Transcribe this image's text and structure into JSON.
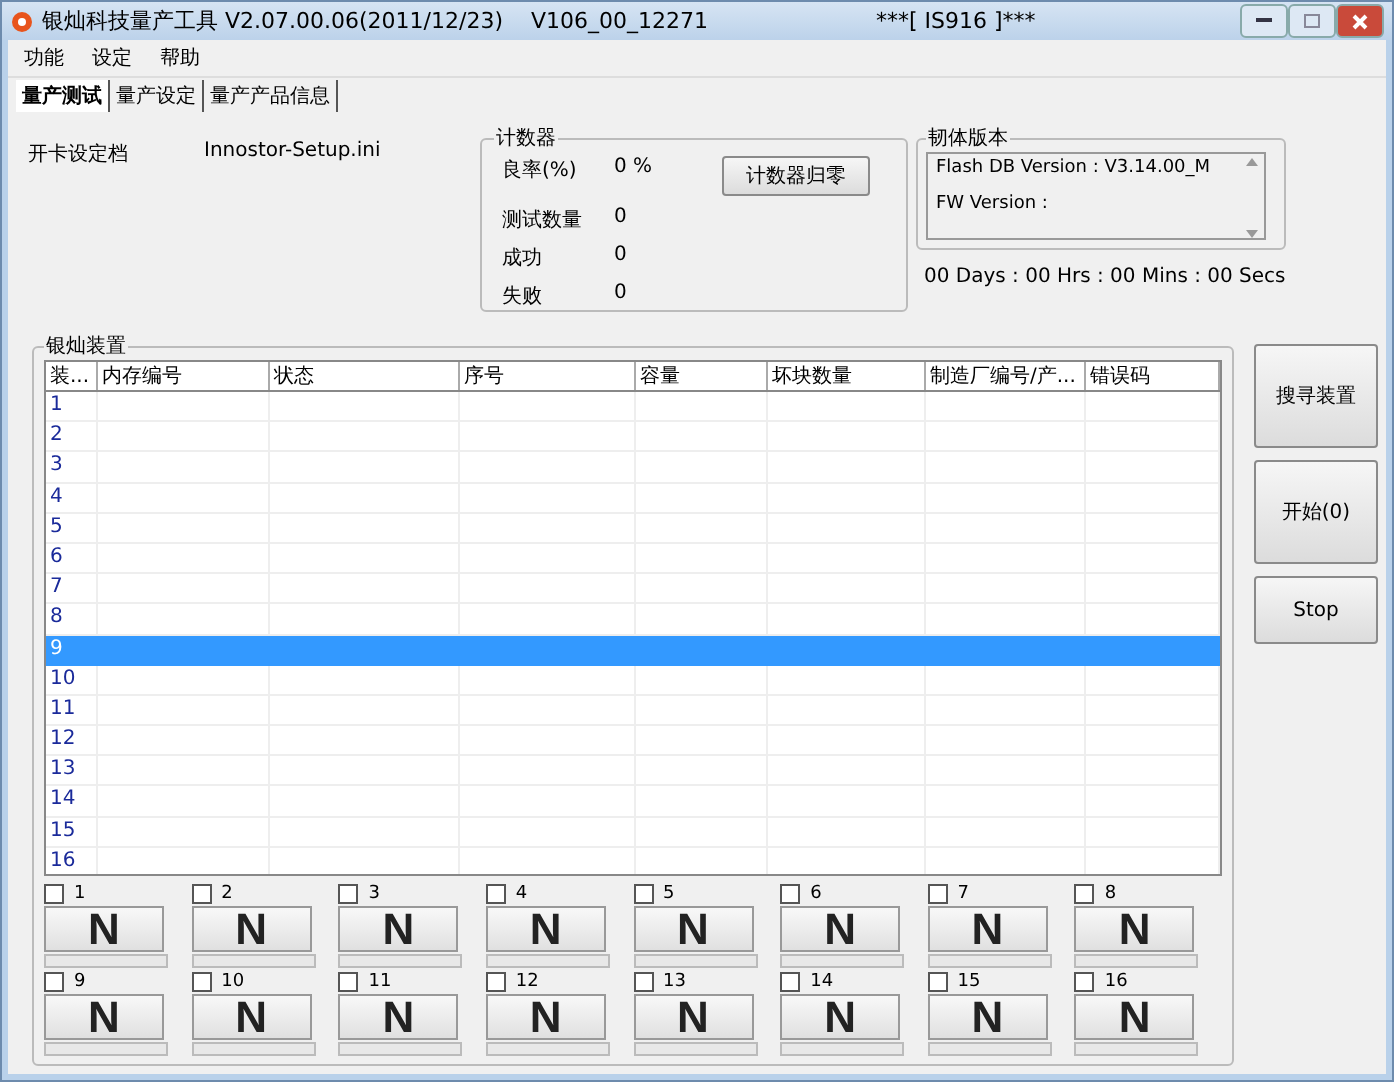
{
  "window": {
    "title": "银灿科技量产工具 V2.07.00.06(2011/12/23)    V106_00_12271",
    "title_right": "***[ IS916 ]***"
  },
  "menu": [
    "功能",
    "设定",
    "帮助"
  ],
  "tabs": [
    {
      "label": "量产测试",
      "selected": true
    },
    {
      "label": "量产设定",
      "selected": false
    },
    {
      "label": "量产产品信息",
      "selected": false
    }
  ],
  "setup": {
    "label": "开卡设定档",
    "value": "Innostor-Setup.ini"
  },
  "counter": {
    "title": "计数器",
    "reset_button": "计数器归零",
    "rows": [
      {
        "label": "良率(%)",
        "value": "0 %"
      },
      {
        "label": "测试数量",
        "value": "0"
      },
      {
        "label": "成功",
        "value": "0"
      },
      {
        "label": "失败",
        "value": "0"
      }
    ]
  },
  "firmware": {
    "title": "韧体版本",
    "lines": [
      "Flash DB Version :  V3.14.00_M",
      "FW Version :"
    ]
  },
  "timer": "00 Days : 00 Hrs : 00 Mins : 00 Secs",
  "devices": {
    "title": "银灿装置",
    "columns": [
      "装...",
      "内存编号",
      "状态",
      "序号",
      "容量",
      "坏块数量",
      "制造厂编号/产...",
      "错误码"
    ],
    "rows": [
      {
        "index": "1",
        "selected": false
      },
      {
        "index": "2",
        "selected": false
      },
      {
        "index": "3",
        "selected": false
      },
      {
        "index": "4",
        "selected": false
      },
      {
        "index": "5",
        "selected": false
      },
      {
        "index": "6",
        "selected": false
      },
      {
        "index": "7",
        "selected": false
      },
      {
        "index": "8",
        "selected": false
      },
      {
        "index": "9",
        "selected": true
      },
      {
        "index": "10",
        "selected": false
      },
      {
        "index": "11",
        "selected": false
      },
      {
        "index": "12",
        "selected": false
      },
      {
        "index": "13",
        "selected": false
      },
      {
        "index": "14",
        "selected": false
      },
      {
        "index": "15",
        "selected": false
      },
      {
        "index": "16",
        "selected": false
      }
    ],
    "slots": [
      {
        "label": "1",
        "checked": false,
        "status": "N",
        "level": 0
      },
      {
        "label": "2",
        "checked": false,
        "status": "N",
        "level": 0
      },
      {
        "label": "3",
        "checked": false,
        "status": "N",
        "level": 0
      },
      {
        "label": "4",
        "checked": false,
        "status": "N",
        "level": 0
      },
      {
        "label": "5",
        "checked": false,
        "status": "N",
        "level": 0
      },
      {
        "label": "6",
        "checked": false,
        "status": "N",
        "level": 0
      },
      {
        "label": "7",
        "checked": false,
        "status": "N",
        "level": 0
      },
      {
        "label": "8",
        "checked": false,
        "status": "N",
        "level": 0
      },
      {
        "label": "9",
        "checked": false,
        "status": "N",
        "level": 0
      },
      {
        "label": "10",
        "checked": false,
        "status": "N",
        "level": 0
      },
      {
        "label": "11",
        "checked": false,
        "status": "N",
        "level": 0
      },
      {
        "label": "12",
        "checked": false,
        "status": "N",
        "level": 0
      },
      {
        "label": "13",
        "checked": false,
        "status": "N",
        "level": 0
      },
      {
        "label": "14",
        "checked": false,
        "status": "N",
        "level": 0
      },
      {
        "label": "15",
        "checked": false,
        "status": "N",
        "level": 0
      },
      {
        "label": "16",
        "checked": false,
        "status": "N",
        "level": 0
      }
    ]
  },
  "side_buttons": [
    "搜寻装置",
    "开始(0)",
    "Stop"
  ]
}
